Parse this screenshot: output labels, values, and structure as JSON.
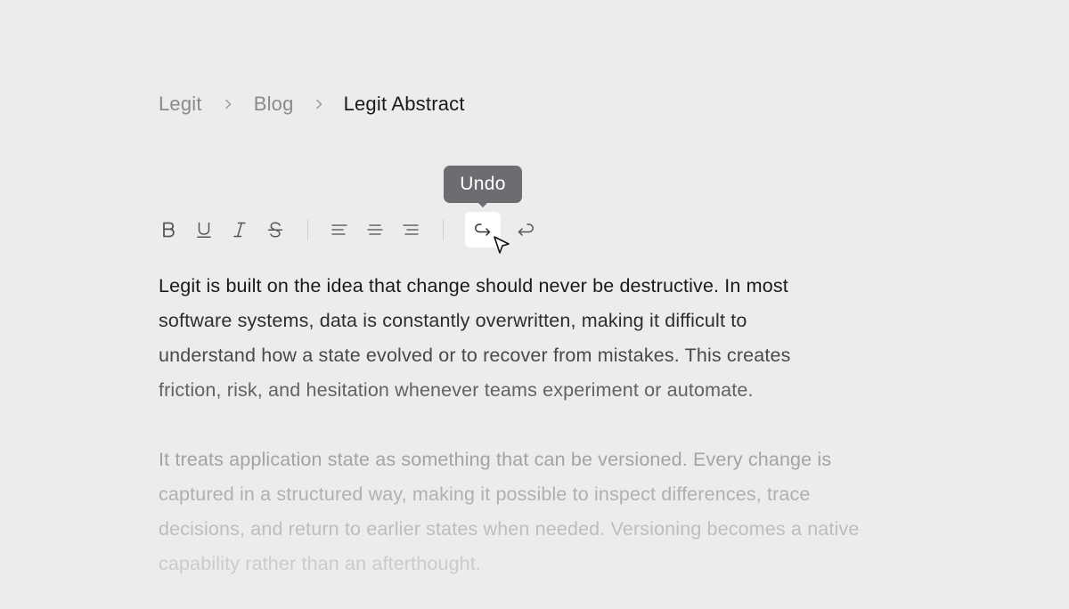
{
  "breadcrumb": {
    "items": [
      {
        "label": "Legit"
      },
      {
        "label": "Blog"
      },
      {
        "label": "Legit Abstract"
      }
    ]
  },
  "tooltip": {
    "label": "Undo"
  },
  "toolbar": {
    "buttons": [
      {
        "name": "bold",
        "glyph": "B"
      },
      {
        "name": "underline",
        "glyph": "U"
      },
      {
        "name": "italic",
        "glyph": "I"
      },
      {
        "name": "strikethrough",
        "glyph": "S"
      },
      {
        "name": "align-left"
      },
      {
        "name": "align-center"
      },
      {
        "name": "align-right"
      },
      {
        "name": "undo",
        "state": "hovered"
      },
      {
        "name": "redo"
      }
    ]
  },
  "content": {
    "paragraphs": [
      {
        "lines": [
          "Legit is built on the idea that change should never be destructive. In most",
          "software systems, data is constantly overwritten, making it difficult to",
          "understand how a state evolved or to recover from mistakes. This creates",
          "friction, risk, and hesitation whenever teams experiment or automate."
        ]
      },
      {
        "lines": [
          "It treats application state as something that can be versioned. Every change is",
          "captured in a structured way, making it possible to inspect differences, trace",
          "decisions, and return to earlier states when needed. Versioning becomes a native",
          "capability rather than an afterthought."
        ]
      }
    ]
  },
  "colors": {
    "background": "#ececec",
    "tooltip_bg": "#6c6d70",
    "text_primary": "#1a1a1a",
    "text_muted": "#8a8a8a"
  }
}
